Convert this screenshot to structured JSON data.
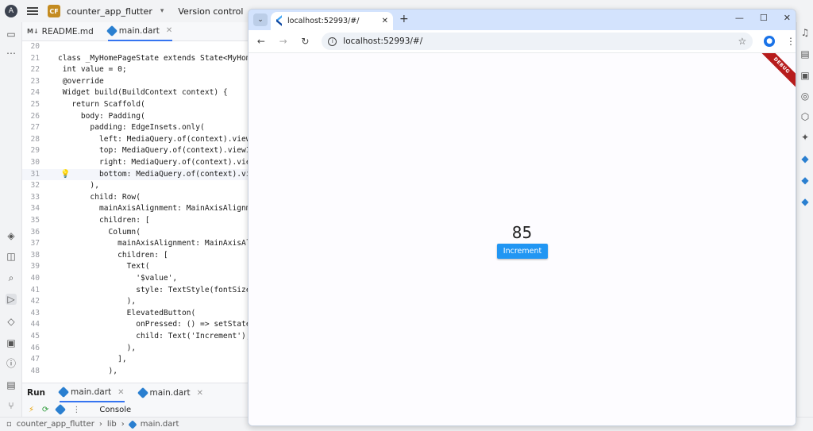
{
  "ide": {
    "project_badge": "CF",
    "project_name": "counter_app_flutter",
    "version_control": "Version control",
    "tabs": [
      {
        "label": "README.md",
        "badge": "M↓"
      },
      {
        "label": "main.dart"
      }
    ],
    "code_lines": [
      {
        "num": "20",
        "text": ""
      },
      {
        "num": "21",
        "text": "class _MyHomePageState extends State<MyHomePa"
      },
      {
        "num": "22",
        "text": " int value = 0;"
      },
      {
        "num": "23",
        "text": " @override"
      },
      {
        "num": "24",
        "text": " Widget build(BuildContext context) {"
      },
      {
        "num": "25",
        "text": "   return Scaffold("
      },
      {
        "num": "26",
        "text": "     body: Padding("
      },
      {
        "num": "27",
        "text": "       padding: EdgeInsets.only("
      },
      {
        "num": "28",
        "text": "         left: MediaQuery.of(context).viewIn"
      },
      {
        "num": "29",
        "text": "         top: MediaQuery.of(context).viewIns"
      },
      {
        "num": "30",
        "text": "         right: MediaQuery.of(context).viewI"
      },
      {
        "num": "31",
        "text": "         bottom: MediaQuery.of(context).view"
      },
      {
        "num": "32",
        "text": "       ),"
      },
      {
        "num": "33",
        "text": "       child: Row("
      },
      {
        "num": "34",
        "text": "         mainAxisAlignment: MainAxisAlignmen"
      },
      {
        "num": "35",
        "text": "         children: ["
      },
      {
        "num": "36",
        "text": "           Column("
      },
      {
        "num": "37",
        "text": "             mainAxisAlignment: MainAxisAlig"
      },
      {
        "num": "38",
        "text": "             children: ["
      },
      {
        "num": "39",
        "text": "               Text("
      },
      {
        "num": "40",
        "text": "                 '$value',"
      },
      {
        "num": "41",
        "text": "                 style: TextStyle(fontSize:"
      },
      {
        "num": "42",
        "text": "               ),"
      },
      {
        "num": "43",
        "text": "               ElevatedButton("
      },
      {
        "num": "44",
        "text": "                 onPressed: () => setState(("
      },
      {
        "num": "45",
        "text": "                 child: Text('Increment'),"
      },
      {
        "num": "46",
        "text": "               ),"
      },
      {
        "num": "47",
        "text": "             ],"
      },
      {
        "num": "48",
        "text": "           ),"
      }
    ],
    "run_panel": {
      "title": "Run",
      "tabs": [
        "main.dart",
        "main.dart"
      ],
      "console_label": "Console"
    },
    "statusbar": {
      "project": "counter_app_flutter",
      "folder": "lib",
      "file": "main.dart"
    }
  },
  "browser": {
    "tab_title": "localhost:52993/#/",
    "url": "localhost:52993/#/"
  },
  "app": {
    "debug_banner": "DEBUG",
    "counter_value": "85",
    "button_label": "Increment"
  }
}
